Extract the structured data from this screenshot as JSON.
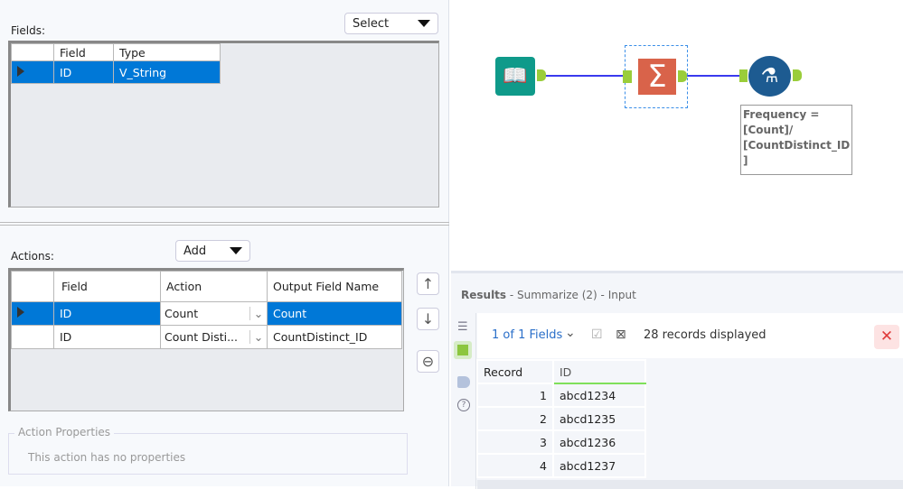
{
  "config": {
    "fields_label": "Fields:",
    "select_dropdown": "Select",
    "fields_table": {
      "columns": [
        "",
        "Field",
        "Type"
      ],
      "rows": [
        {
          "field": "ID",
          "type": "V_String",
          "selected": true
        }
      ]
    },
    "actions_label": "Actions:",
    "add_dropdown": "Add",
    "actions_table": {
      "columns": [
        "",
        "Field",
        "Action",
        "Output Field Name"
      ],
      "rows": [
        {
          "field": "ID",
          "action": "Count",
          "output": "Count",
          "selected": true
        },
        {
          "field": "ID",
          "action": "Count Disti...",
          "output": "CountDistinct_ID",
          "selected": false
        }
      ]
    },
    "buttons": {
      "up": "↑",
      "down": "↓",
      "remove": "⊖"
    },
    "action_properties": {
      "legend": "Action Properties",
      "text": "This action has no properties"
    }
  },
  "canvas": {
    "tools": [
      {
        "icon": "input-data-icon",
        "color": "#0f9a8a"
      },
      {
        "icon": "summarize-icon",
        "color": "#d9634a"
      },
      {
        "icon": "formula-icon",
        "color": "#1d5b91"
      }
    ],
    "annotation": "Frequency =\n[Count]/\n[CountDistinct_ID\n]",
    "connector_color": "#3a3aee"
  },
  "results": {
    "title": "Results",
    "subtitle": " - Summarize (2) - Input",
    "fields_selector": "1 of 1 Fields",
    "records_text": "28 records displayed",
    "columns": [
      "Record",
      "ID"
    ],
    "rows": [
      {
        "record": "1",
        "id": "abcd1234"
      },
      {
        "record": "2",
        "id": "abcd1235"
      },
      {
        "record": "3",
        "id": "abcd1236"
      },
      {
        "record": "4",
        "id": "abcd1237"
      }
    ]
  }
}
